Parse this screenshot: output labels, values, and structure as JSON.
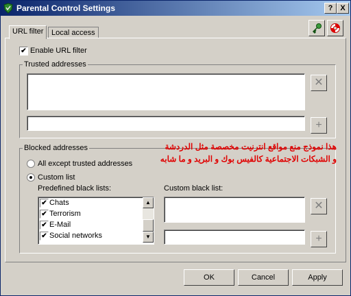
{
  "window": {
    "title": "Parental Control Settings",
    "help_button": "?",
    "close_button": "X"
  },
  "tabs": [
    {
      "label": "URL filter",
      "active": true
    },
    {
      "label": "Local access",
      "active": false
    }
  ],
  "toolbar_icons": {
    "key": "key-icon",
    "help": "lifebuoy-icon"
  },
  "enable_filter": {
    "label": "Enable URL filter",
    "checked": true
  },
  "trusted": {
    "title": "Trusted addresses",
    "list_items": [],
    "input_value": ""
  },
  "blocked": {
    "title": "Blocked addresses",
    "option_all": {
      "label": "All except trusted addresses",
      "selected": false
    },
    "option_custom": {
      "label": "Custom list",
      "selected": true
    },
    "predefined_label": "Predefined black lists:",
    "predefined": [
      {
        "label": "Chats",
        "checked": true
      },
      {
        "label": "Terrorism",
        "checked": true
      },
      {
        "label": "E-Mail",
        "checked": true
      },
      {
        "label": "Social networks",
        "checked": true
      }
    ],
    "custom_label": "Custom black list:",
    "custom_input_value": ""
  },
  "annotation": {
    "line1": "هذا نموذج منع مواقع انترنيت مخصصة مثل الدردشة",
    "line2": "و الشبكات الاجتماعية كالفيس بوك و البريد و ما شابه",
    "color": "#e00000"
  },
  "buttons": {
    "ok": "OK",
    "cancel": "Cancel",
    "apply": "Apply"
  }
}
